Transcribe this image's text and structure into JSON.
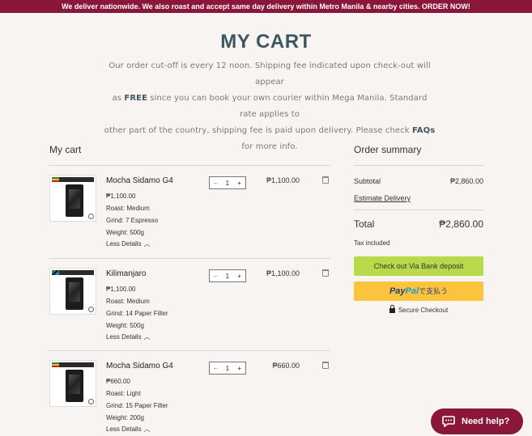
{
  "banner": {
    "text": "We deliver nationwide. We also roast and accept same day delivery within Metro Manila & nearby cities. ORDER NOW!"
  },
  "page": {
    "title": "MY CART"
  },
  "intro": {
    "line1": "Our order cut-off is every 12 noon. Shipping fee indicated upon check-out will appear",
    "line2_pre": "as ",
    "line2_free": "FREE",
    "line2_post": " since you can book your own courier within Mega Manila. Standard rate applies to",
    "line3_pre": "other part of the country, shipping fee is paid upon delivery. Please check ",
    "line3_faqs": "FAQs",
    "line3_post": " for more info."
  },
  "cart": {
    "heading": "My cart",
    "less_details_label": "Less Details",
    "items": [
      {
        "name": "Mocha Sidamo G4",
        "unit_price": "₱1,100.00",
        "roast": "Roast: Medium",
        "grind": "Grind: 7 Espresso",
        "weight": "Weight: 500g",
        "qty": "1",
        "line_total": "₱1,100.00",
        "flag": "ethiopia"
      },
      {
        "name": "Kilimanjaro",
        "unit_price": "₱1,100.00",
        "roast": "Roast: Medium",
        "grind": "Grind: 14 Paper Filter",
        "weight": "Weight: 500g",
        "qty": "1",
        "line_total": "₱1,100.00",
        "flag": "tanzania"
      },
      {
        "name": "Mocha Sidamo G4",
        "unit_price": "₱660.00",
        "roast": "Roast: Light",
        "grind": "Grind: 15 Paper Filter",
        "weight": "Weight: 200g",
        "qty": "1",
        "line_total": "₱660.00",
        "flag": "ethiopia"
      }
    ]
  },
  "summary": {
    "heading": "Order summary",
    "subtotal_label": "Subtotal",
    "subtotal_value": "₱2,860.00",
    "estimate_label": "Estimate Delivery",
    "total_label": "Total",
    "total_value": "₱2,860.00",
    "tax_note": "Tax included",
    "bank_button": "Check out Via Bank deposit",
    "paypal_pay": "Pay",
    "paypal_pal": "Pal",
    "paypal_jp": "で支払う",
    "secure_label": "Secure Checkout"
  },
  "help": {
    "label": "Need help?"
  },
  "colors": {
    "brand": "#8a1739",
    "heading": "#3e5663",
    "bank_button": "#b8d94a",
    "paypal_button": "#fcc33c"
  }
}
